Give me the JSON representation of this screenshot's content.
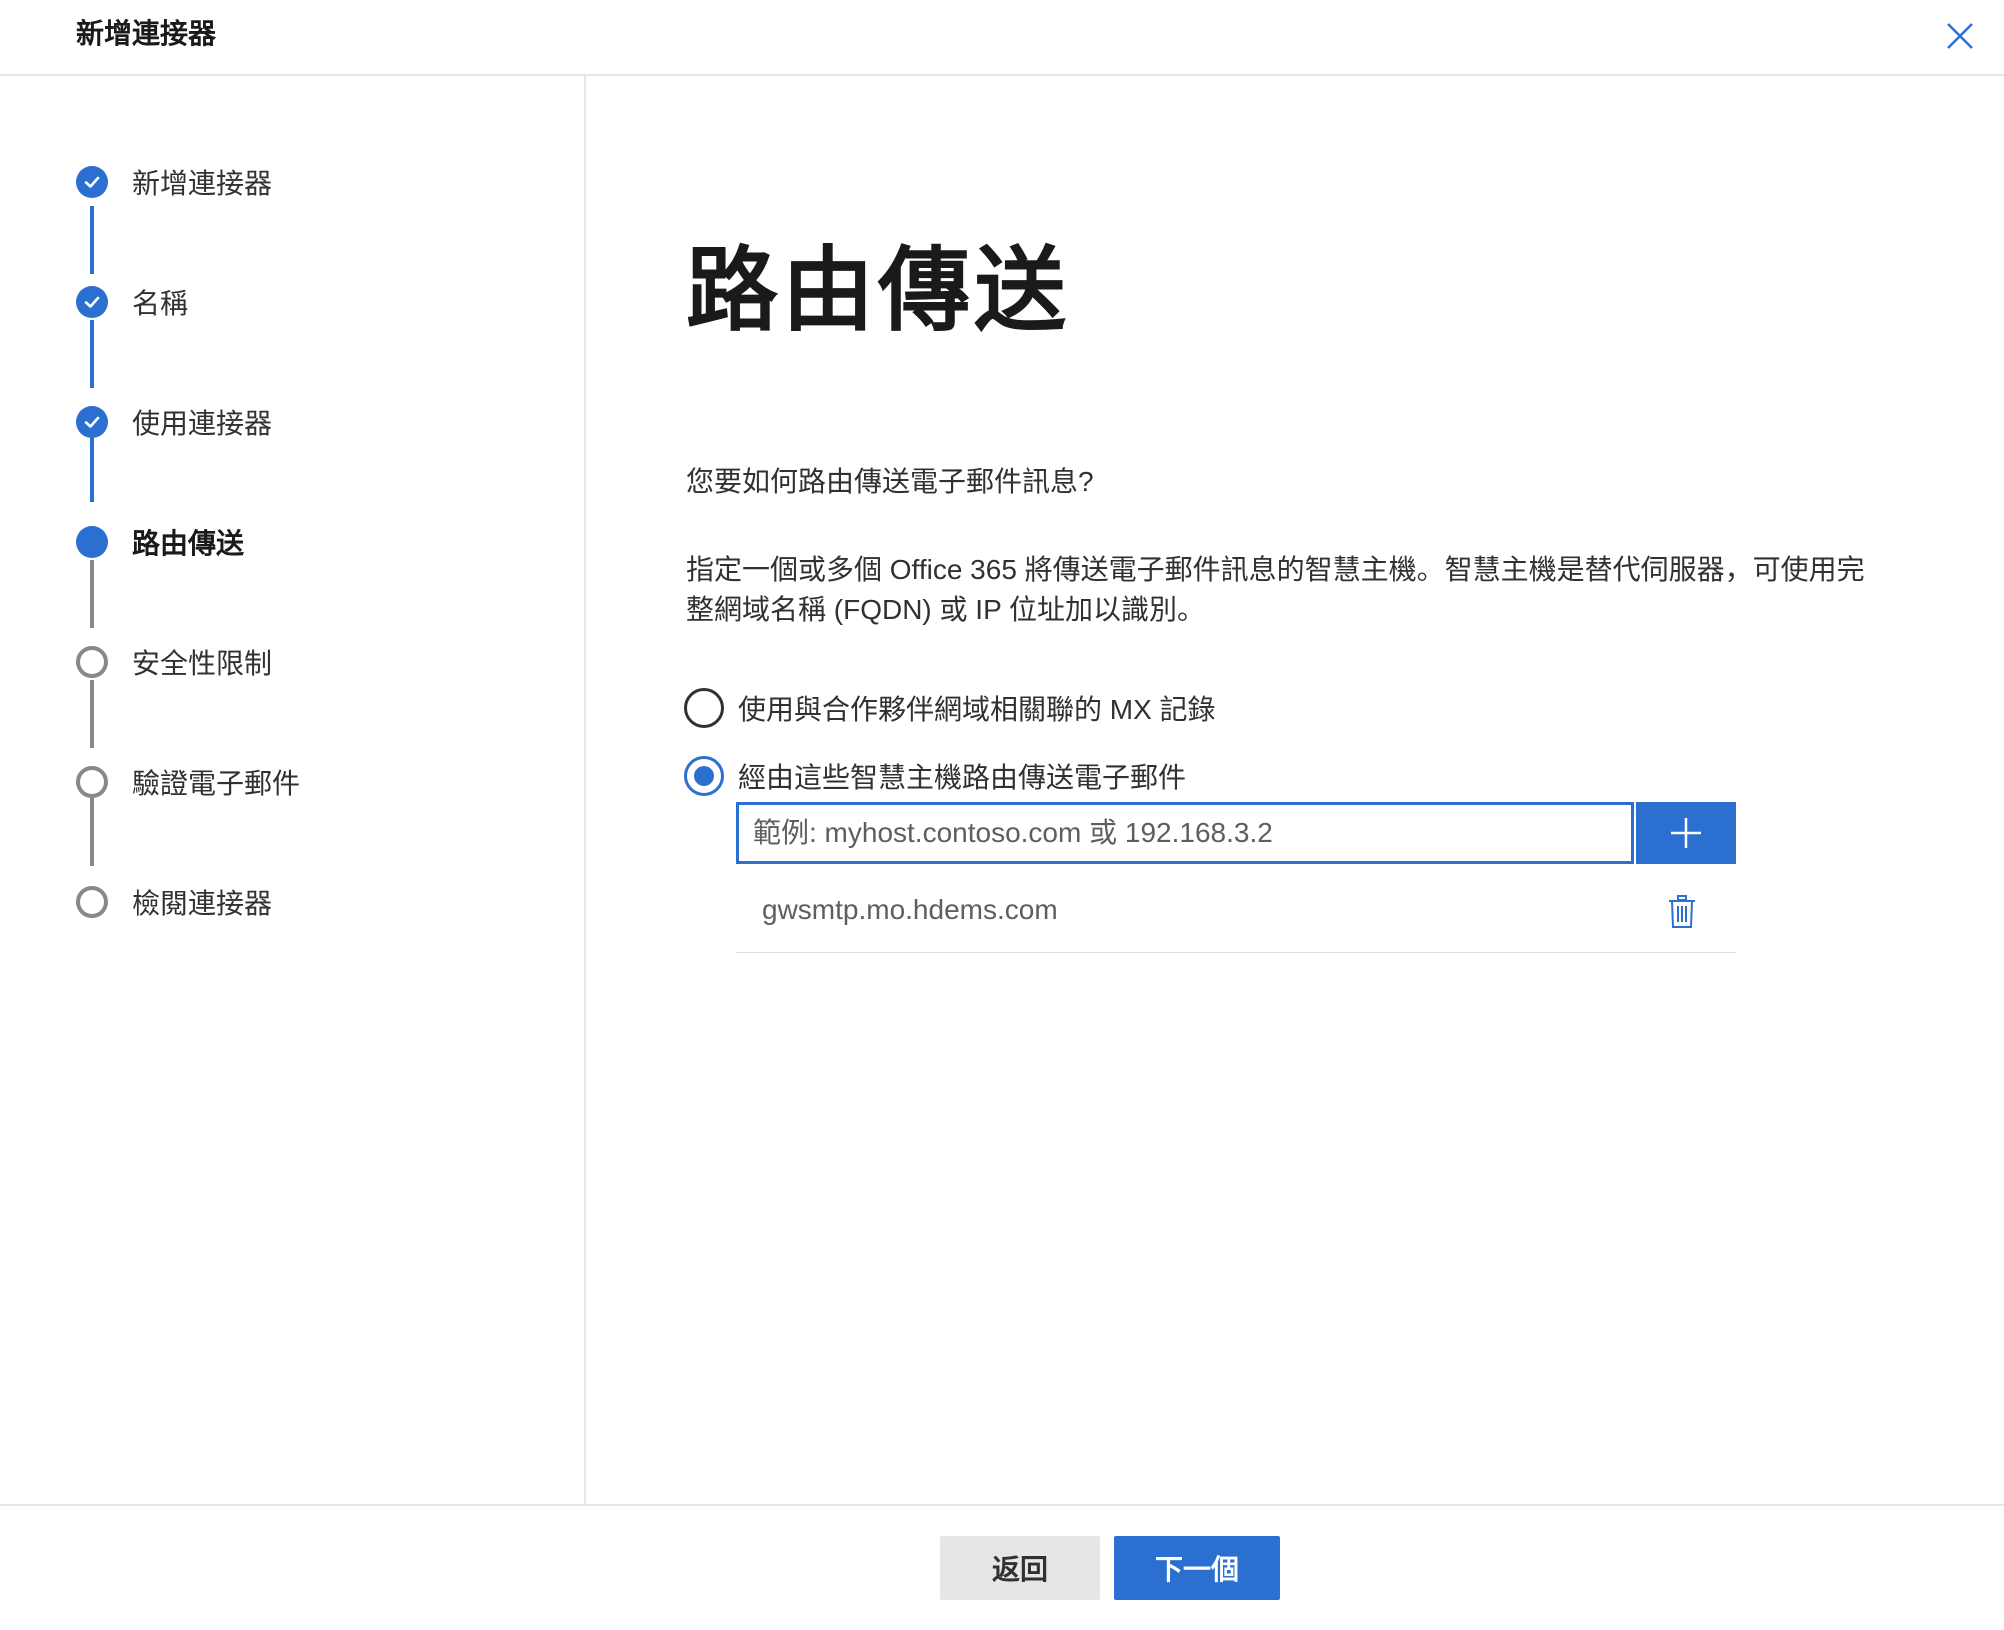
{
  "header": {
    "title": "新增連接器",
    "close_icon": "close-icon"
  },
  "stepper": {
    "steps": [
      {
        "label": "新增連接器",
        "state": "done"
      },
      {
        "label": "名稱",
        "state": "done"
      },
      {
        "label": "使用連接器",
        "state": "done"
      },
      {
        "label": "路由傳送",
        "state": "current"
      },
      {
        "label": "安全性限制",
        "state": "todo"
      },
      {
        "label": "驗證電子郵件",
        "state": "todo"
      },
      {
        "label": "檢閱連接器",
        "state": "todo"
      }
    ]
  },
  "main": {
    "title": "路由傳送",
    "question": "您要如何路由傳送電子郵件訊息?",
    "description": "指定一個或多個 Office 365 將傳送電子郵件訊息的智慧主機。智慧主機是替代伺服器，可使用完整網域名稱 (FQDN) 或 IP 位址加以識別。",
    "options": [
      {
        "label": "使用與合作夥伴網域相關聯的 MX 記錄",
        "checked": false
      },
      {
        "label": "經由這些智慧主機路由傳送電子郵件",
        "checked": true
      }
    ],
    "host_input": {
      "value": "",
      "placeholder": "範例: myhost.contoso.com 或 192.168.3.2"
    },
    "add_icon": "plus-icon",
    "hosts": [
      {
        "name": "gwsmtp.mo.hdems.com",
        "delete_icon": "trash-icon"
      }
    ]
  },
  "footer": {
    "back_label": "返回",
    "next_label": "下一個"
  },
  "colors": {
    "accent": "#2b6fd1",
    "todo_gray": "#8a8886"
  }
}
